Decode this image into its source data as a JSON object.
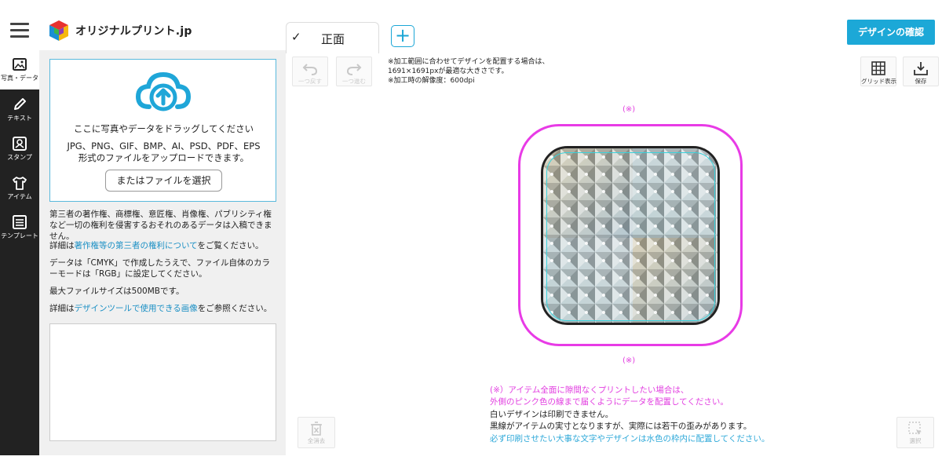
{
  "header": {
    "logo_text": "オリジナルプリント.jp",
    "tab_label": "正面",
    "add_tab": "+",
    "confirm_button": "デザインの確認",
    "colors": {
      "accent": "#1ca8d7",
      "sidebar": "#222222"
    }
  },
  "sidebar": {
    "items": [
      {
        "label": "写真・データ",
        "icon": "image-icon",
        "active": true
      },
      {
        "label": "テキスト",
        "icon": "pen-icon",
        "active": false
      },
      {
        "label": "スタンプ",
        "icon": "stamp-icon",
        "active": false
      },
      {
        "label": "アイテム",
        "icon": "tshirt-icon",
        "active": false
      },
      {
        "label": "テンプレート",
        "icon": "template-list-icon",
        "active": false
      }
    ]
  },
  "panel": {
    "upload": {
      "drag_text": "ここに写真やデータをドラッグしてください",
      "formats_line1": "JPG、PNG、GIF、BMP、AI、PSD、PDF、EPS",
      "formats_line2": "形式のファイルをアップロードできます。",
      "select_button": "またはファイルを選択"
    },
    "rights_note": "第三者の著作権、商標権、意匠権、肖像権、パブリシティ権など一切の権利を侵害するおそれのあるデータは入稿できません。",
    "rights_detail_prefix": "詳細は",
    "rights_detail_link": "著作権等の第三者の権利について",
    "rights_detail_suffix": "をご覧ください。",
    "cmyk_note": "データは「CMYK」で作成したうえで、ファイル自体のカラーモードは「RGB」に設定してください。",
    "max_size_note": "最大ファイルサイズは500MBです。",
    "tool_detail_prefix": "詳細は",
    "tool_detail_link": "デザインツールで使用できる画像",
    "tool_detail_suffix": "をご参照ください。"
  },
  "canvas": {
    "undo_label": "一つ戻す",
    "redo_label": "一つ進む",
    "info_line1": "※加工範囲に合わせてデザインを配置する場合は、",
    "info_line2": "1691×1691pxが最適な大きさです。",
    "info_line3": "※加工時の解像度：600dpi",
    "grid_label": "グリッド表示",
    "save_label": "保存",
    "mark_top": "(※)",
    "mark_bottom": "(※)",
    "legend_line1": "(※）アイテム全面に隙間なくプリントしたい場合は、",
    "legend_line2": "外側のピンク色の線まで届くようにデータを配置してください。",
    "legend_line3": "白いデザインは印刷できません。",
    "legend_line4": "黒線がアイテムの実寸となりますが、実際には若干の歪みがあります。",
    "legend_line5": "必ず印刷させたい大事な文字やデザインは水色の枠内に配置してください。",
    "clear_label": "全消去",
    "select_label": "選択",
    "colors": {
      "bleed_line": "#e83be6",
      "safe_line": "#38d2dc",
      "item_outline": "#222222"
    }
  }
}
